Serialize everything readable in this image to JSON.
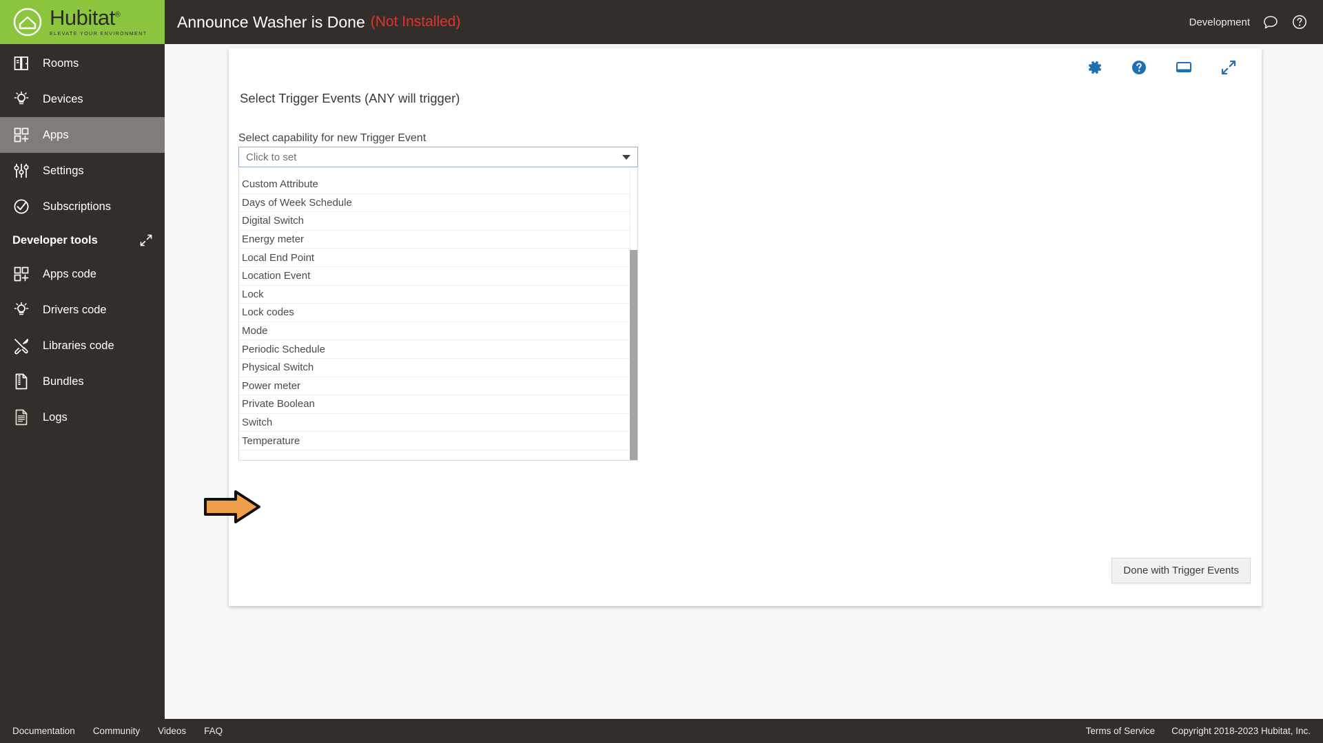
{
  "header": {
    "brand": {
      "word": "Hubitat",
      "trademark": "®",
      "tagline": "ELEVATE YOUR ENVIRONMENT"
    },
    "app_title": "Announce Washer is Done",
    "app_status": "(Not Installed)",
    "env_label": "Development",
    "icons": [
      "chat-bubble-icon",
      "help-circle-icon"
    ],
    "status_color": "#e8302a"
  },
  "sidebar": {
    "items": [
      {
        "label": "Rooms",
        "icon": "rooms-door-icon",
        "active": false
      },
      {
        "label": "Devices",
        "icon": "lightbulb-icon",
        "active": false
      },
      {
        "label": "Apps",
        "icon": "apps-grid-icon",
        "active": true
      },
      {
        "label": "Settings",
        "icon": "sliders-icon",
        "active": false
      },
      {
        "label": "Subscriptions",
        "icon": "check-circle-icon",
        "active": false
      }
    ],
    "section_title": "Developer tools",
    "dev_items": [
      {
        "label": "Apps code",
        "icon": "apps-grid-icon"
      },
      {
        "label": "Drivers code",
        "icon": "lightbulb-icon"
      },
      {
        "label": "Libraries code",
        "icon": "tools-icon"
      },
      {
        "label": "Bundles",
        "icon": "zip-file-icon"
      },
      {
        "label": "Logs",
        "icon": "document-icon"
      }
    ],
    "active_bg": "#807c79"
  },
  "card": {
    "tools": [
      "gear-icon",
      "help-circle-icon",
      "display-icon",
      "expand-icon"
    ],
    "tool_color": "#1f6fb5",
    "heading": "Select Trigger Events (ANY will trigger)",
    "field_label": "Select capability for new Trigger Event",
    "select_placeholder": "Click to set",
    "dropdown_options": [
      "Custom Attribute",
      "Days of Week Schedule",
      "Digital Switch",
      "Energy meter",
      "Local End Point",
      "Location Event",
      "Lock",
      "Lock codes",
      "Mode",
      "Periodic Schedule",
      "Physical Switch",
      "Power meter",
      "Private Boolean",
      "Switch",
      "Temperature"
    ],
    "annotated_option": "Power meter",
    "done_button": "Done with Trigger Events"
  },
  "footer": {
    "links": [
      "Documentation",
      "Community",
      "Videos",
      "FAQ"
    ],
    "terms": "Terms of Service",
    "copyright": "Copyright 2018-2023 Hubitat, Inc."
  }
}
